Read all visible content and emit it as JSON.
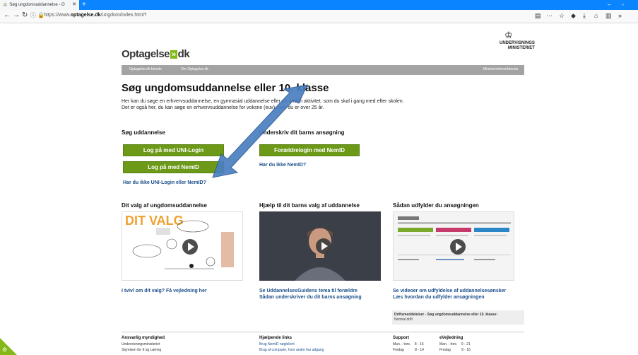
{
  "browser": {
    "tab_title": "Søg ungdomsuddannelse - O",
    "url_prefix": "https://www.",
    "url_domain": "optagelse.dk",
    "url_path": "/ungdom/index.html?"
  },
  "site": {
    "logo_left": "Optagelse",
    "logo_box": "»",
    "logo_right": "dk",
    "ministry_line1": "UNDERVISNINGS",
    "ministry_line2": "MINISTERIET",
    "menu": [
      "Optagelse.dk forside",
      "Om Optagelse.dk"
    ],
    "menu_right": "Ministeriet/områdeudu"
  },
  "main": {
    "title": "Søg ungdomsuddannelse eller 10. klasse",
    "intro_line1": "Her kan du søge en erhvervsuddannelse, en gymnasial uddannelse eller en anden aktivitet, som du skal i gang med efter skolen.",
    "intro_line2": "Det er også her, du kan søge en erhvervsuddannelse for voksne (euv), hvis du er over 25 år.",
    "left_heading": "Søg uddannelse",
    "btn_uni": "Log på med UNI-Login",
    "btn_nemid": "Log på med NemID",
    "link_no_login": "Har du ikke UNI-Login eller NemID?",
    "right_heading": "Underskriv dit barns ansøgning",
    "btn_parent": "Forældrelogin med NemID",
    "link_no_nemid": "Har du ikke NemID?"
  },
  "videos": [
    {
      "heading": "Dit valg af ungdomsuddannelse",
      "thumb_text": "DIT VALG",
      "caption1": "I tvivl om dit valg? Få vejledning her",
      "caption2": ""
    },
    {
      "heading": "Hjælp til dit barns valg af uddannelse",
      "thumb_text": "",
      "caption1": "Se UddannelsesGuidens tema til forældre",
      "caption2": "Sådan underskriver du dit barns ansøgning"
    },
    {
      "heading": "Sådan udfylder du ansøgningen",
      "thumb_text": "",
      "caption1": "Se videoer om udfyldelse af uddannelsesønsker",
      "caption2": "Læs hvordan du udfylder ansøgningen"
    }
  ],
  "status": {
    "line1": "Driftsmeddelelser - Søg ungdomsuddannelse eller 10. klasse:",
    "line2": "Normal drift"
  },
  "footer": {
    "col1_head": "Ansvarlig myndighed",
    "col1_l1": "Undervisningsministeriet",
    "col1_l2": "Styrelsen for It og Læring",
    "col2_head": "Hjælpende links",
    "col2_l1": "Brug NemID nøglekort",
    "col2_l2": "Brug af computer, hvor andre har adgang",
    "col3_head": "Support",
    "col3_l1": "Man. - tors.    8 - 16",
    "col3_l2": "Fredag           8 - 14",
    "col4_head": "eVejledning",
    "col4_l1": "Man. - tors.    9 - 21",
    "col4_l2": "Fredag           9 - 16"
  },
  "colors": {
    "accent_green": "#6c9a18",
    "link_blue": "#1a4f8b",
    "browser_blue": "#0a84ff"
  }
}
